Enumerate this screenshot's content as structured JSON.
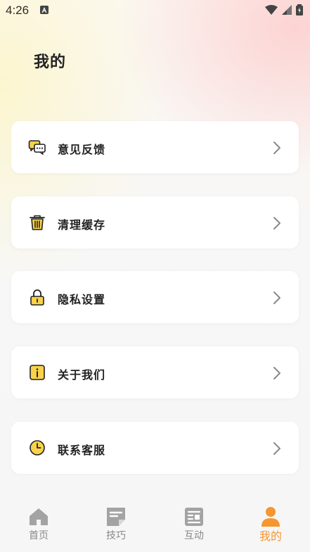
{
  "status_bar": {
    "time": "4:26"
  },
  "page": {
    "title": "我的"
  },
  "menu": [
    {
      "label": "意见反馈",
      "icon": "chat-bubbles-icon"
    },
    {
      "label": "清理缓存",
      "icon": "trash-icon"
    },
    {
      "label": "隐私设置",
      "icon": "lock-icon"
    },
    {
      "label": "关于我们",
      "icon": "info-icon"
    },
    {
      "label": "联系客服",
      "icon": "clock-icon"
    }
  ],
  "tabs": [
    {
      "label": "首页",
      "icon": "home-icon",
      "active": false
    },
    {
      "label": "技巧",
      "icon": "note-icon",
      "active": false
    },
    {
      "label": "互动",
      "icon": "newspaper-icon",
      "active": false
    },
    {
      "label": "我的",
      "icon": "person-icon",
      "active": true
    }
  ],
  "colors": {
    "accent": "#f5962f",
    "icon_yellow": "#f7d24a",
    "tab_inactive": "#9a9a9a",
    "text": "#222222"
  }
}
